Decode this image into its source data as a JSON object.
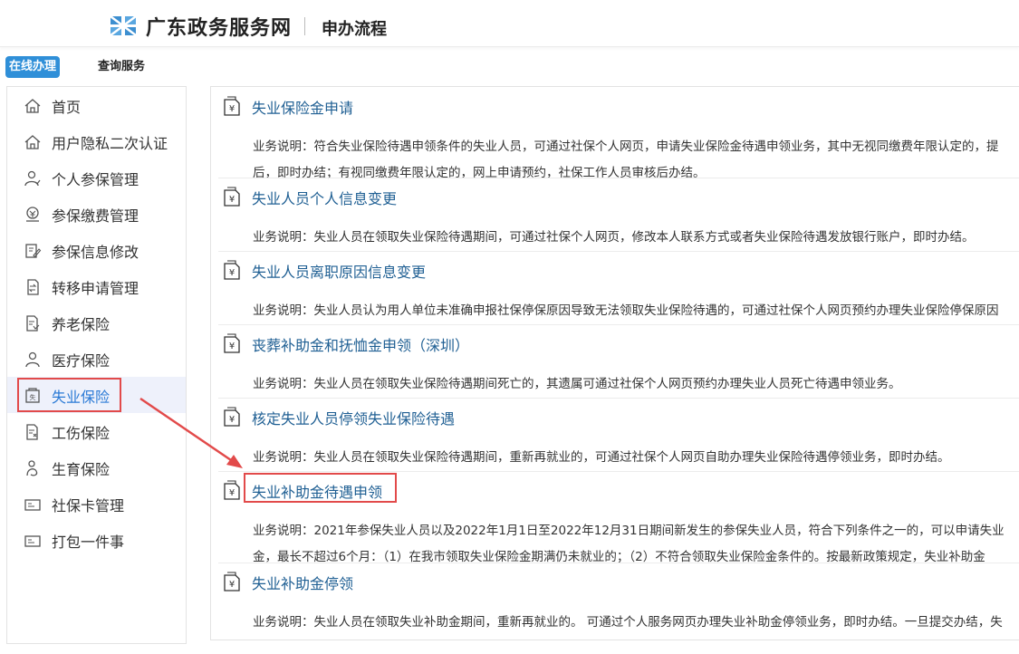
{
  "header": {
    "site_name": "广东政务服务网",
    "page_subtitle": "申办流程",
    "logo_icon": "gd-gov-logo-icon"
  },
  "tabs": {
    "online": "在线办理",
    "query": "查询服务",
    "active_color": "#2f8fd8"
  },
  "sidebar": {
    "items": [
      {
        "label": "首页",
        "icon": "home-icon"
      },
      {
        "label": "用户隐私二次认证",
        "icon": "home-icon"
      },
      {
        "label": "个人参保管理",
        "icon": "user-icon"
      },
      {
        "label": "参保缴费管理",
        "icon": "payment-icon"
      },
      {
        "label": "参保信息修改",
        "icon": "edit-icon"
      },
      {
        "label": "转移申请管理",
        "icon": "transfer-icon"
      },
      {
        "label": "养老保险",
        "icon": "document-icon"
      },
      {
        "label": "医疗保险",
        "icon": "user-icon"
      },
      {
        "label": "失业保险",
        "icon": "unemployment-icon",
        "active": true
      },
      {
        "label": "工伤保险",
        "icon": "document-icon"
      },
      {
        "label": "生育保险",
        "icon": "user-icon"
      },
      {
        "label": "社保卡管理",
        "icon": "card-icon"
      },
      {
        "label": "打包一件事",
        "icon": "card-icon"
      }
    ]
  },
  "services": [
    {
      "title": "失业保险金申请",
      "desc": [
        "业务说明：符合失业保险待遇申领条件的失业人员，可通过社保个人网页，申请失业保险金待遇申领业务，其中无视同缴费年限认定的，提",
        "后，即时办结；有视同缴费年限认定的，网上申请预约，社保工作人员审核后办结。"
      ]
    },
    {
      "title": "失业人员个人信息变更",
      "desc": [
        "业务说明：失业人员在领取失业保险待遇期间，可通过社保个人网页，修改本人联系方式或者失业保险待遇发放银行账户，即时办结。"
      ]
    },
    {
      "title": "失业人员离职原因信息变更",
      "desc": [
        "业务说明：失业人员认为用人单位未准确申报社保停保原因导致无法领取失业保险待遇的，可通过社保个人网页预约办理失业保险停保原因"
      ]
    },
    {
      "title": "丧葬补助金和抚恤金申领（深圳）",
      "desc": [
        "业务说明：失业人员在领取失业保险待遇期间死亡的，其遗属可通过社保个人网页预约办理失业人员死亡待遇申领业务。"
      ]
    },
    {
      "title": "核定失业人员停领失业保险待遇",
      "desc": [
        "业务说明：失业人员在领取失业保险待遇期间，重新再就业的，可通过社保个人网页自助办理失业保险待遇停领业务，即时办结。"
      ]
    },
    {
      "title": "失业补助金待遇申领",
      "desc": [
        "业务说明：2021年参保失业人员以及2022年1月1日至2022年12月31日期间新发生的参保失业人员，符合下列条件之一的，可以申请失业",
        "金，最长不超过6个月：（1）在我市领取失业保险金期满仍未就业的；（2）不符合领取失业保险金条件的。按最新政策规定，失业补助金"
      ]
    },
    {
      "title": "失业补助金停领",
      "desc": [
        "业务说明：失业人员在领取失业补助金期间，重新再就业的。 可通过个人服务网页办理失业补助金停领业务，即时办结。一旦提交办结，失"
      ]
    }
  ],
  "colors": {
    "link": "#1f5f93",
    "highlight": "#e24a4a",
    "active_bg": "#eef1fb"
  }
}
